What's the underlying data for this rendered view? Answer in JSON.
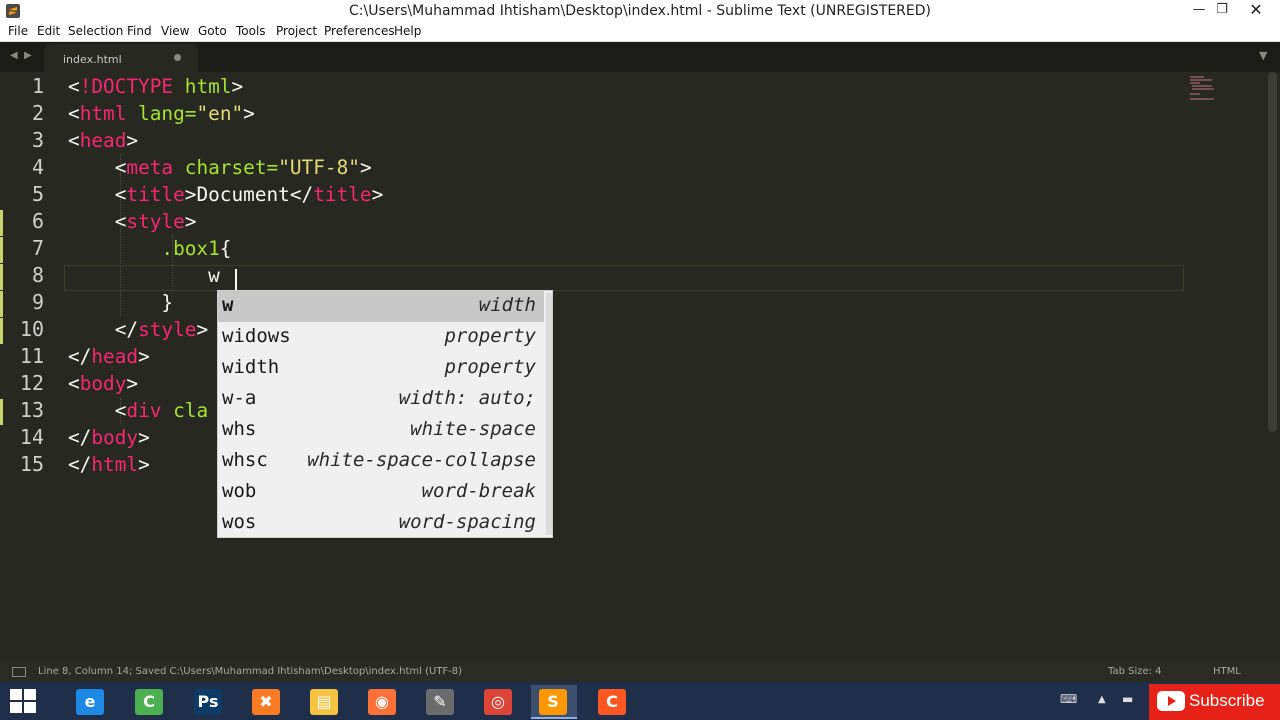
{
  "window": {
    "title": "C:\\Users\\Muhammad Ihtisham\\Desktop\\index.html - Sublime Text (UNREGISTERED)",
    "min_glyph": "—",
    "max_glyph": "❐",
    "close_glyph": "✕"
  },
  "menu": [
    "File",
    "Edit",
    "Selection",
    "Find",
    "View",
    "Goto",
    "Tools",
    "Project",
    "Preferences",
    "Help"
  ],
  "tabs": {
    "nav_left": "◀",
    "nav_right": "▶",
    "active_label": "index.html",
    "dropdown": "▼"
  },
  "editor": {
    "line_numbers": [
      "1",
      "2",
      "3",
      "4",
      "5",
      "6",
      "7",
      "8",
      "9",
      "10",
      "11",
      "12",
      "13",
      "14",
      "15"
    ],
    "lines": [
      "<!DOCTYPE html>",
      "<html lang=\"en\">",
      "<head>",
      "    <meta charset=\"UTF-8\">",
      "    <title>Document</title>",
      "    <style>",
      "        .box1{",
      "            w",
      "        }",
      "    </style>",
      "</head>",
      "<body>",
      "    <div cla",
      "</body>",
      "</html>"
    ]
  },
  "autocomplete": {
    "items": [
      {
        "trigger": "w",
        "desc": "width"
      },
      {
        "trigger": "widows",
        "desc": "property"
      },
      {
        "trigger": "width",
        "desc": "property"
      },
      {
        "trigger": "w-a",
        "desc": "width: auto;"
      },
      {
        "trigger": "whs",
        "desc": "white-space"
      },
      {
        "trigger": "whsc",
        "desc": "white-space-collapse"
      },
      {
        "trigger": "wob",
        "desc": "word-break"
      },
      {
        "trigger": "wos",
        "desc": "word-spacing"
      }
    ],
    "selected_index": 0
  },
  "status": {
    "text": "Line 8, Column 14; Saved C:\\Users\\Muhammad Ihtisham\\Desktop\\index.html (UTF-8)",
    "tab_size": "Tab Size: 4",
    "syntax": "HTML"
  },
  "taskbar": {
    "apps": [
      {
        "name": "internet-explorer-icon",
        "glyph": "e",
        "color": "#1e88e5"
      },
      {
        "name": "camtasia-green-icon",
        "glyph": "C",
        "color": "#4caf50"
      },
      {
        "name": "photoshop-icon",
        "glyph": "Ps",
        "color": "#0d3b66"
      },
      {
        "name": "xampp-icon",
        "glyph": "✖",
        "color": "#fb7a24"
      },
      {
        "name": "file-explorer-icon",
        "glyph": "▤",
        "color": "#f6c342"
      },
      {
        "name": "firefox-icon",
        "glyph": "◉",
        "color": "#ff7139"
      },
      {
        "name": "tool-icon",
        "glyph": "✎",
        "color": "#6b6b6b"
      },
      {
        "name": "chrome-icon",
        "glyph": "◎",
        "color": "#db4437"
      },
      {
        "name": "sublime-text-icon",
        "glyph": "S",
        "color": "#ff9800"
      },
      {
        "name": "camtasia-orange-icon",
        "glyph": "C",
        "color": "#ff5722"
      }
    ],
    "tray_keyboard": "⌨",
    "tray_arrow": "▲",
    "tray_net": "▬",
    "subscribe_label": "Subscribe"
  }
}
